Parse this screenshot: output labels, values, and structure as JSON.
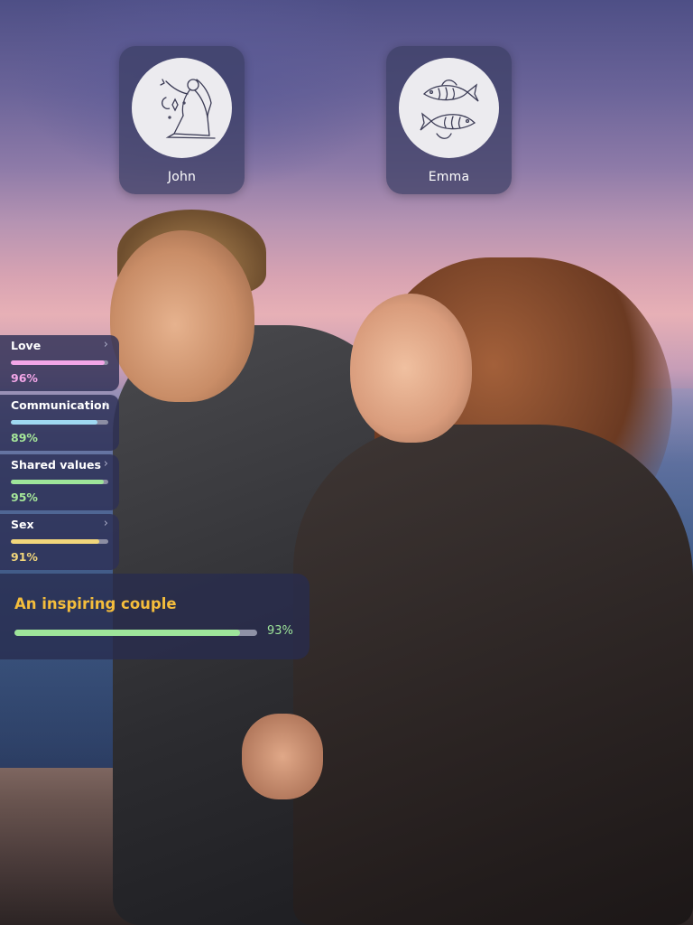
{
  "profiles": [
    {
      "name": "John",
      "sign_icon": "virgo-icon"
    },
    {
      "name": "Emma",
      "sign_icon": "pisces-icon"
    }
  ],
  "metrics": [
    {
      "label": "Love",
      "value_text": "96%",
      "fraction": 0.96,
      "bar_color": "#f3a6e8",
      "text_color": "#f3a6e8"
    },
    {
      "label": "Communication",
      "value_text": "89%",
      "fraction": 0.89,
      "bar_color": "#9fd8f1",
      "text_color": "#a6e79a"
    },
    {
      "label": "Shared values",
      "value_text": "95%",
      "fraction": 0.95,
      "bar_color": "#9ee59a",
      "text_color": "#a6e79a"
    },
    {
      "label": "Sex",
      "value_text": "91%",
      "fraction": 0.91,
      "bar_color": "#f1d67b",
      "text_color": "#f1d67b"
    }
  ],
  "summary": {
    "title": "An inspiring couple",
    "value_text": "93%",
    "fraction": 0.93,
    "bar_color": "#9ee59a",
    "title_color": "#f4bd3c"
  },
  "chevron": "›"
}
